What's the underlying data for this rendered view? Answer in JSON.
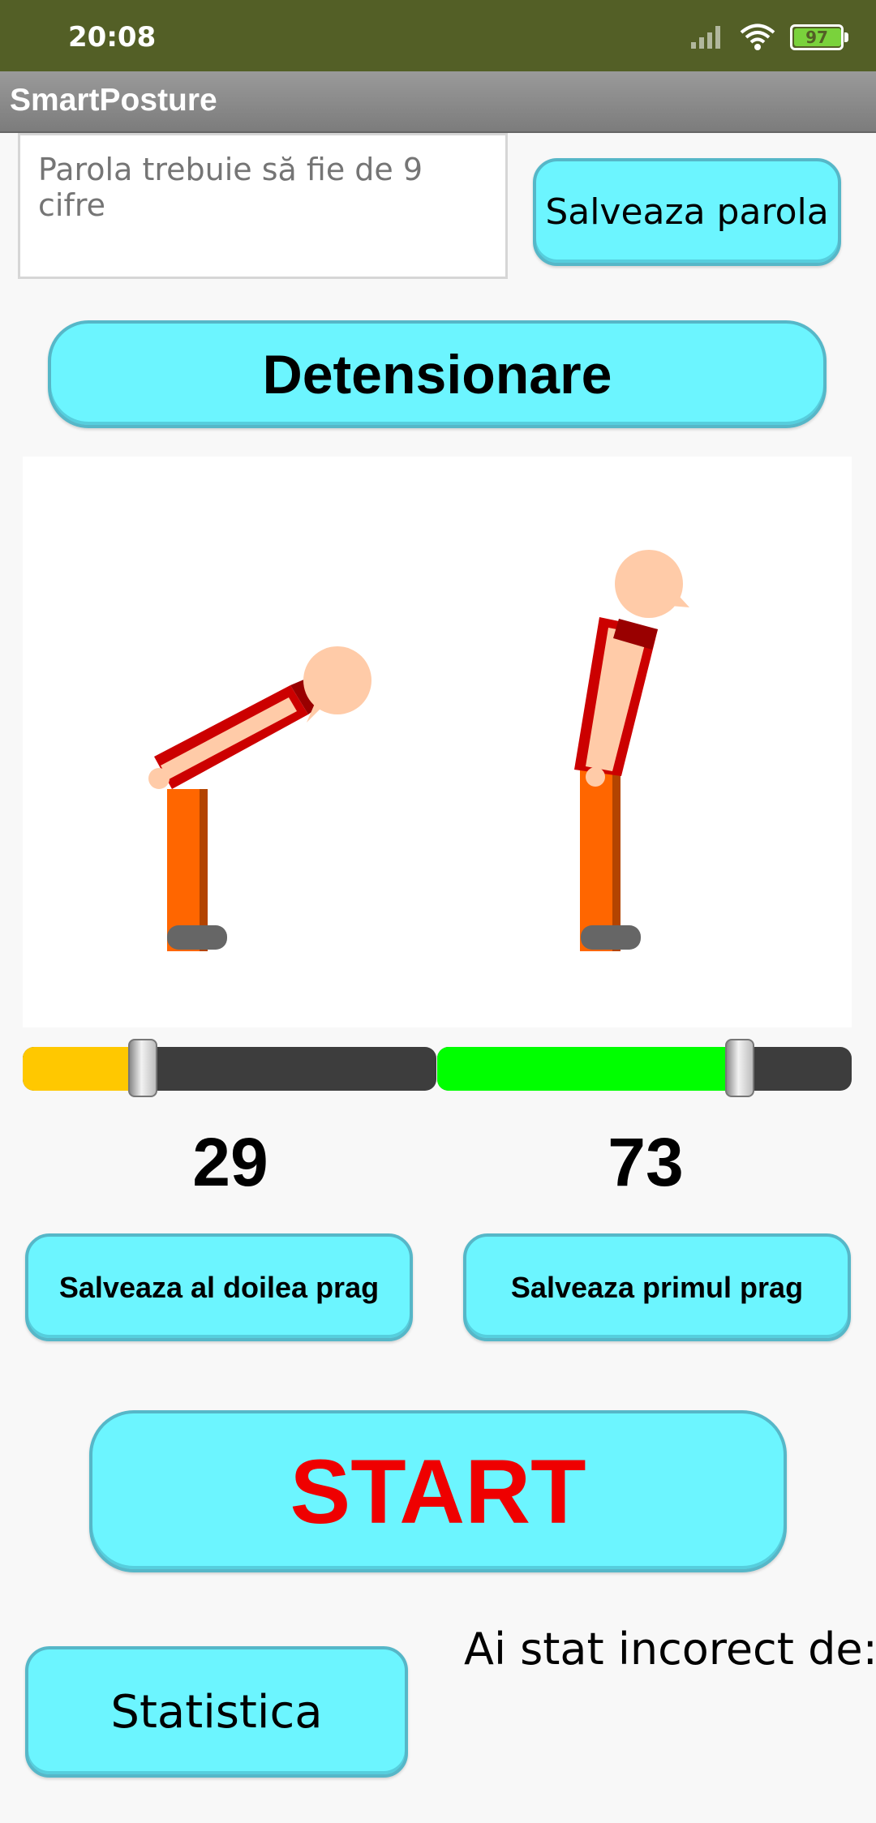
{
  "status_bar": {
    "time": "20:08",
    "battery": "97",
    "battery_level": 0.97,
    "signal_icon": "signal-icon",
    "wifi_icon": "wifi-icon"
  },
  "app": {
    "title": "SmartPosture"
  },
  "password": {
    "placeholder": "Parola trebuie să fie de 9 cifre",
    "value": ""
  },
  "buttons": {
    "save_password": "Salveaza parola",
    "detensionare": "Detensionare",
    "save_second_threshold": "Salveaza al doilea prag",
    "save_first_threshold": "Salveaza primul prag",
    "start": "START",
    "statistics": "Statistica"
  },
  "sliders": {
    "left": {
      "value": 29,
      "display": "29",
      "fill_color": "#ffc800"
    },
    "right": {
      "value": 73,
      "display": "73",
      "fill_color": "#00ff00"
    }
  },
  "labels": {
    "incorrect": "Ai stat incorect de:"
  },
  "colors": {
    "status_bar": "#535f26",
    "button_bg": "#6cf5ff",
    "start_text": "#ef0000",
    "shirt": "#cc0000",
    "pants": "#ff6600",
    "skin": "#ffcba8",
    "shoe": "#666666"
  }
}
